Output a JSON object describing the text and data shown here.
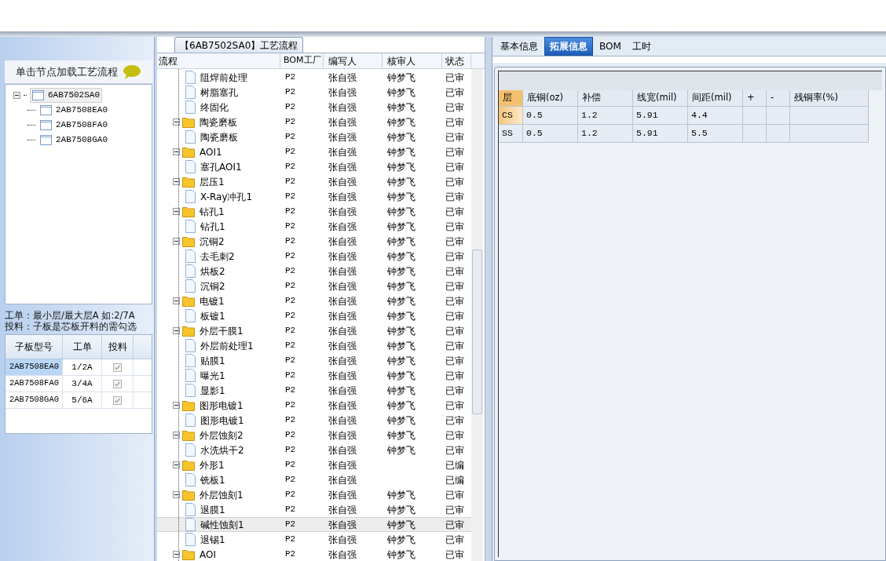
{
  "left_panel": {
    "header": "单击节点加载工艺流程",
    "tree": [
      {
        "label": "6AB7502SA0",
        "expanded": true,
        "selected": true,
        "children": [
          {
            "label": "2AB7508EA0",
            "selected": false
          },
          {
            "label": "2AB7508FA0",
            "selected": false
          },
          {
            "label": "2AB7508GA0",
            "selected": false
          }
        ]
      }
    ],
    "notes": [
      "工单：最小层/最大层A 如:2/7A",
      "投料：子板是芯板开料的需勾选"
    ],
    "table": {
      "columns": [
        "子板型号",
        "工单",
        "投料"
      ],
      "rows": [
        {
          "model": "2AB7508EA0",
          "order": "1/2A",
          "checked": true,
          "selected": true
        },
        {
          "model": "2AB7508FA0",
          "order": "3/4A",
          "checked": true,
          "selected": false
        },
        {
          "model": "2AB7508GA0",
          "order": "5/6A",
          "checked": true,
          "selected": false
        }
      ]
    }
  },
  "flow_panel": {
    "title": "【6AB7502SA0】工艺流程",
    "columns": [
      "流程",
      "BOM工厂",
      "编写人",
      "核审人",
      "状态"
    ],
    "rows": [
      {
        "kind": "file",
        "label": "阻焊前处理",
        "factory": "P2",
        "writer": "张自强",
        "reviewer": "钟梦飞",
        "status": "已审",
        "selected": false
      },
      {
        "kind": "file",
        "label": "树脂塞孔",
        "factory": "P2",
        "writer": "张自强",
        "reviewer": "钟梦飞",
        "status": "已审",
        "selected": false
      },
      {
        "kind": "file",
        "label": "终固化",
        "factory": "P2",
        "writer": "张自强",
        "reviewer": "钟梦飞",
        "status": "已审",
        "selected": false
      },
      {
        "kind": "folder",
        "label": "陶瓷磨板",
        "factory": "P2",
        "writer": "张自强",
        "reviewer": "钟梦飞",
        "status": "已审",
        "selected": false,
        "expanded": true,
        "children": [
          {
            "kind": "file",
            "label": "陶瓷磨板",
            "factory": "P2",
            "writer": "张自强",
            "reviewer": "钟梦飞",
            "status": "已审",
            "selected": false
          }
        ]
      },
      {
        "kind": "folder",
        "label": "AOI1",
        "factory": "P2",
        "writer": "张自强",
        "reviewer": "钟梦飞",
        "status": "已审",
        "selected": false,
        "expanded": true,
        "children": [
          {
            "kind": "file",
            "label": "塞孔AOI1",
            "factory": "P2",
            "writer": "张自强",
            "reviewer": "钟梦飞",
            "status": "已审",
            "selected": false
          }
        ]
      },
      {
        "kind": "folder",
        "label": "层压1",
        "factory": "P2",
        "writer": "张自强",
        "reviewer": "钟梦飞",
        "status": "已审",
        "selected": false,
        "expanded": true,
        "children": [
          {
            "kind": "file",
            "label": "X-Ray冲孔1",
            "factory": "P2",
            "writer": "张自强",
            "reviewer": "钟梦飞",
            "status": "已审",
            "selected": false
          }
        ]
      },
      {
        "kind": "folder",
        "label": "钻孔1",
        "factory": "P2",
        "writer": "张自强",
        "reviewer": "钟梦飞",
        "status": "已审",
        "selected": false,
        "expanded": true,
        "children": [
          {
            "kind": "file",
            "label": "钻孔1",
            "factory": "P2",
            "writer": "张自强",
            "reviewer": "钟梦飞",
            "status": "已审",
            "selected": false
          }
        ]
      },
      {
        "kind": "folder",
        "label": "沉铜2",
        "factory": "P2",
        "writer": "张自强",
        "reviewer": "钟梦飞",
        "status": "已审",
        "selected": false,
        "expanded": true,
        "children": [
          {
            "kind": "file",
            "label": "去毛刺2",
            "factory": "P2",
            "writer": "张自强",
            "reviewer": "钟梦飞",
            "status": "已审",
            "selected": false
          },
          {
            "kind": "file",
            "label": "烘板2",
            "factory": "P2",
            "writer": "张自强",
            "reviewer": "钟梦飞",
            "status": "已审",
            "selected": false
          },
          {
            "kind": "file",
            "label": "沉铜2",
            "factory": "P2",
            "writer": "张自强",
            "reviewer": "钟梦飞",
            "status": "已审",
            "selected": false
          }
        ]
      },
      {
        "kind": "folder",
        "label": "电镀1",
        "factory": "P2",
        "writer": "张自强",
        "reviewer": "钟梦飞",
        "status": "已审",
        "selected": false,
        "expanded": true,
        "children": [
          {
            "kind": "file",
            "label": "板镀1",
            "factory": "P2",
            "writer": "张自强",
            "reviewer": "钟梦飞",
            "status": "已审",
            "selected": false
          }
        ]
      },
      {
        "kind": "folder",
        "label": "外层干膜1",
        "factory": "P2",
        "writer": "张自强",
        "reviewer": "钟梦飞",
        "status": "已审",
        "selected": false,
        "expanded": true,
        "children": [
          {
            "kind": "file",
            "label": "外层前处理1",
            "factory": "P2",
            "writer": "张自强",
            "reviewer": "钟梦飞",
            "status": "已审",
            "selected": false
          },
          {
            "kind": "file",
            "label": "贴膜1",
            "factory": "P2",
            "writer": "张自强",
            "reviewer": "钟梦飞",
            "status": "已审",
            "selected": false
          },
          {
            "kind": "file",
            "label": "曝光1",
            "factory": "P2",
            "writer": "张自强",
            "reviewer": "钟梦飞",
            "status": "已审",
            "selected": false
          },
          {
            "kind": "file",
            "label": "显影1",
            "factory": "P2",
            "writer": "张自强",
            "reviewer": "钟梦飞",
            "status": "已审",
            "selected": false
          }
        ]
      },
      {
        "kind": "folder",
        "label": "图形电镀1",
        "factory": "P2",
        "writer": "张自强",
        "reviewer": "钟梦飞",
        "status": "已审",
        "selected": false,
        "expanded": true,
        "children": [
          {
            "kind": "file",
            "label": "图形电镀1",
            "factory": "P2",
            "writer": "张自强",
            "reviewer": "钟梦飞",
            "status": "已审",
            "selected": false
          }
        ]
      },
      {
        "kind": "folder",
        "label": "外层蚀刻2",
        "factory": "P2",
        "writer": "张自强",
        "reviewer": "钟梦飞",
        "status": "已审",
        "selected": false,
        "expanded": true,
        "children": [
          {
            "kind": "file",
            "label": "水洗烘干2",
            "factory": "P2",
            "writer": "张自强",
            "reviewer": "钟梦飞",
            "status": "已审",
            "selected": false
          }
        ]
      },
      {
        "kind": "folder",
        "label": "外形1",
        "factory": "P2",
        "writer": "张自强",
        "status": "已编",
        "selected": false,
        "expanded": true,
        "children": [
          {
            "kind": "file",
            "label": "铣板1",
            "factory": "P2",
            "writer": "张自强",
            "status": "已编",
            "selected": false
          }
        ]
      },
      {
        "kind": "folder",
        "label": "外层蚀刻1",
        "factory": "P2",
        "writer": "张自强",
        "reviewer": "钟梦飞",
        "status": "已审",
        "selected": false,
        "expanded": true,
        "children": [
          {
            "kind": "file",
            "label": "退膜1",
            "factory": "P2",
            "writer": "张自强",
            "reviewer": "钟梦飞",
            "status": "已审",
            "selected": false
          },
          {
            "kind": "file",
            "label": "碱性蚀刻1",
            "factory": "P2",
            "writer": "张自强",
            "reviewer": "钟梦飞",
            "status": "已审",
            "selected": true
          },
          {
            "kind": "file",
            "label": "退锡1",
            "factory": "P2",
            "writer": "张自强",
            "reviewer": "钟梦飞",
            "status": "已审",
            "selected": false
          }
        ]
      },
      {
        "kind": "folder",
        "label": "AOI",
        "factory": "P2",
        "writer": "张自强",
        "reviewer": "钟梦飞",
        "status": "已审",
        "selected": false,
        "expanded": true
      }
    ]
  },
  "detail_panel": {
    "tabs": [
      {
        "label": "基本信息",
        "selected": false
      },
      {
        "label": "拓展信息",
        "selected": true
      },
      {
        "label": "BOM",
        "selected": false
      },
      {
        "label": "工时",
        "selected": false
      }
    ],
    "table": {
      "columns": [
        "层",
        "底铜(oz)",
        "补偿",
        "线宽(mil)",
        "间距(mil)",
        "+",
        "-",
        "残铜率(%)"
      ],
      "rows": [
        [
          "CS",
          "0.5",
          "1.2",
          "5.91",
          "4.4"
        ],
        [
          "SS",
          "0.5",
          "1.2",
          "5.91",
          "5.5"
        ]
      ]
    }
  }
}
